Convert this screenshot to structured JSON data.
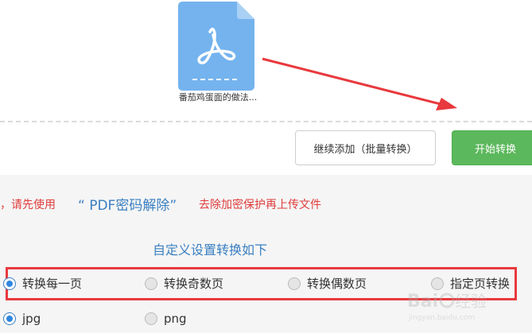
{
  "file": {
    "name": "番茄鸡蛋面的做法..."
  },
  "buttons": {
    "add_more": "继续添加（批量转换）",
    "start": "开始转换"
  },
  "notice": {
    "pre": "，请先使用",
    "link": "“ PDF密码解除”",
    "post": "去除加密保护再上传文件"
  },
  "settings": {
    "title": "自定义设置转换如下"
  },
  "page_options": [
    {
      "label": "转换每一页",
      "checked": true
    },
    {
      "label": "转换奇数页",
      "checked": false
    },
    {
      "label": "转换偶数页",
      "checked": false
    },
    {
      "label": "指定页转换",
      "checked": false
    }
  ],
  "format_options": [
    {
      "label": "jpg",
      "checked": true
    },
    {
      "label": "png",
      "checked": false
    }
  ],
  "colors": {
    "accent": "#3a7fc1",
    "start_button": "#5cb85c",
    "highlight_box": "#e8393d",
    "warning_text": "#e03c3c",
    "file_icon": "#74b3ee"
  }
}
